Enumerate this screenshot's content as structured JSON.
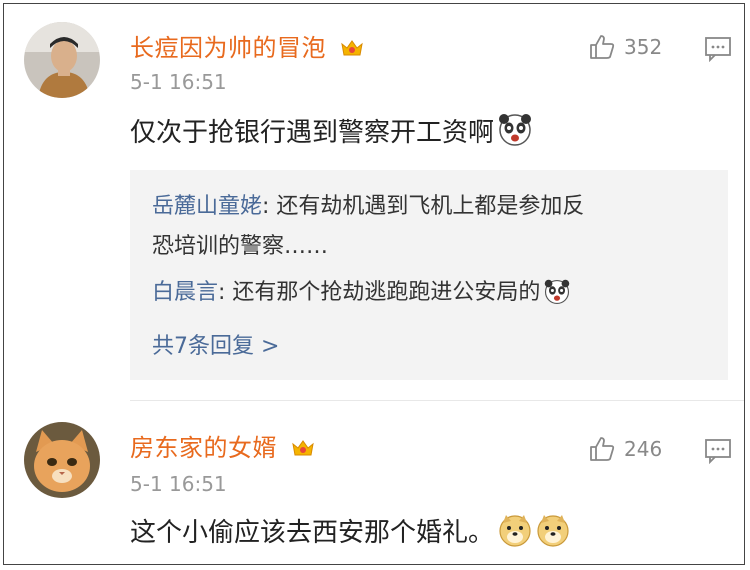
{
  "comments": [
    {
      "username": "长痘因为帅的冒泡",
      "time": "5-1 16:51",
      "text": "仅次于抢银行遇到警察开工资啊",
      "likes": "352",
      "replies": [
        {
          "author": "岳麓山童姥",
          "sep": ": ",
          "line1": "还有劫机遇到飞机上都是参加反",
          "line2": "恐培训的警察……"
        },
        {
          "author": "白晨言",
          "sep": ": ",
          "line1": "还有那个抢劫逃跑跑进公安局的"
        }
      ],
      "more_replies": "共7条回复 >"
    },
    {
      "username": "房东家的女婿",
      "time": "5-1 16:51",
      "text": "这个小偷应该去西安那个婚礼。",
      "likes": "246"
    }
  ],
  "colors": {
    "username": "#e86a1e",
    "reply_author": "#4a6a98",
    "reply_bg": "#f3f3f3",
    "meta": "#999999"
  },
  "icons": [
    "vip-crown-icon",
    "thumbs-up-icon",
    "comment-icon",
    "panda-emoji",
    "doge-emoji"
  ]
}
